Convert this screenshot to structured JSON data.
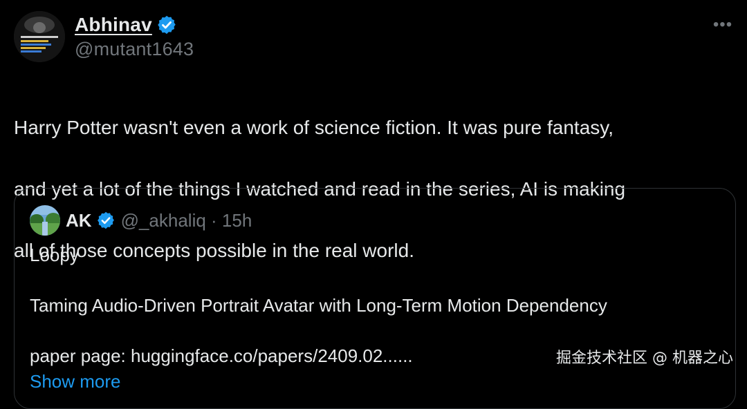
{
  "tweet": {
    "author": {
      "name": "Abhinav",
      "handle": "@mutant1643",
      "verified": true,
      "avatar_icon": "book-cover-avatar-icon"
    },
    "more_icon": "more-options-icon",
    "more_glyph": "•••",
    "text_lines": [
      "Harry Potter wasn't even a work of science fiction. It was pure fantasy,",
      "and yet a lot of the things I watched and read in the series, AI is making",
      "all of those concepts possible in the real world."
    ]
  },
  "quote": {
    "author": {
      "name": "AK",
      "handle": "@_akhaliq · 15h",
      "verified": true,
      "avatar_icon": "landscape-avatar-icon"
    },
    "lines": {
      "title": "Loopy",
      "subtitle": "Taming Audio-Driven Portrait Avatar with Long-Term Motion Dependency",
      "link": "paper page: huggingface.co/papers/2409.02......",
      "show_more": "Show more"
    }
  },
  "watermark": "掘金技术社区 @ 机器之心",
  "colors": {
    "background": "#000000",
    "text": "#e7e9ea",
    "muted": "#71767b",
    "accent": "#1d9bf0",
    "border": "#2f3336"
  }
}
